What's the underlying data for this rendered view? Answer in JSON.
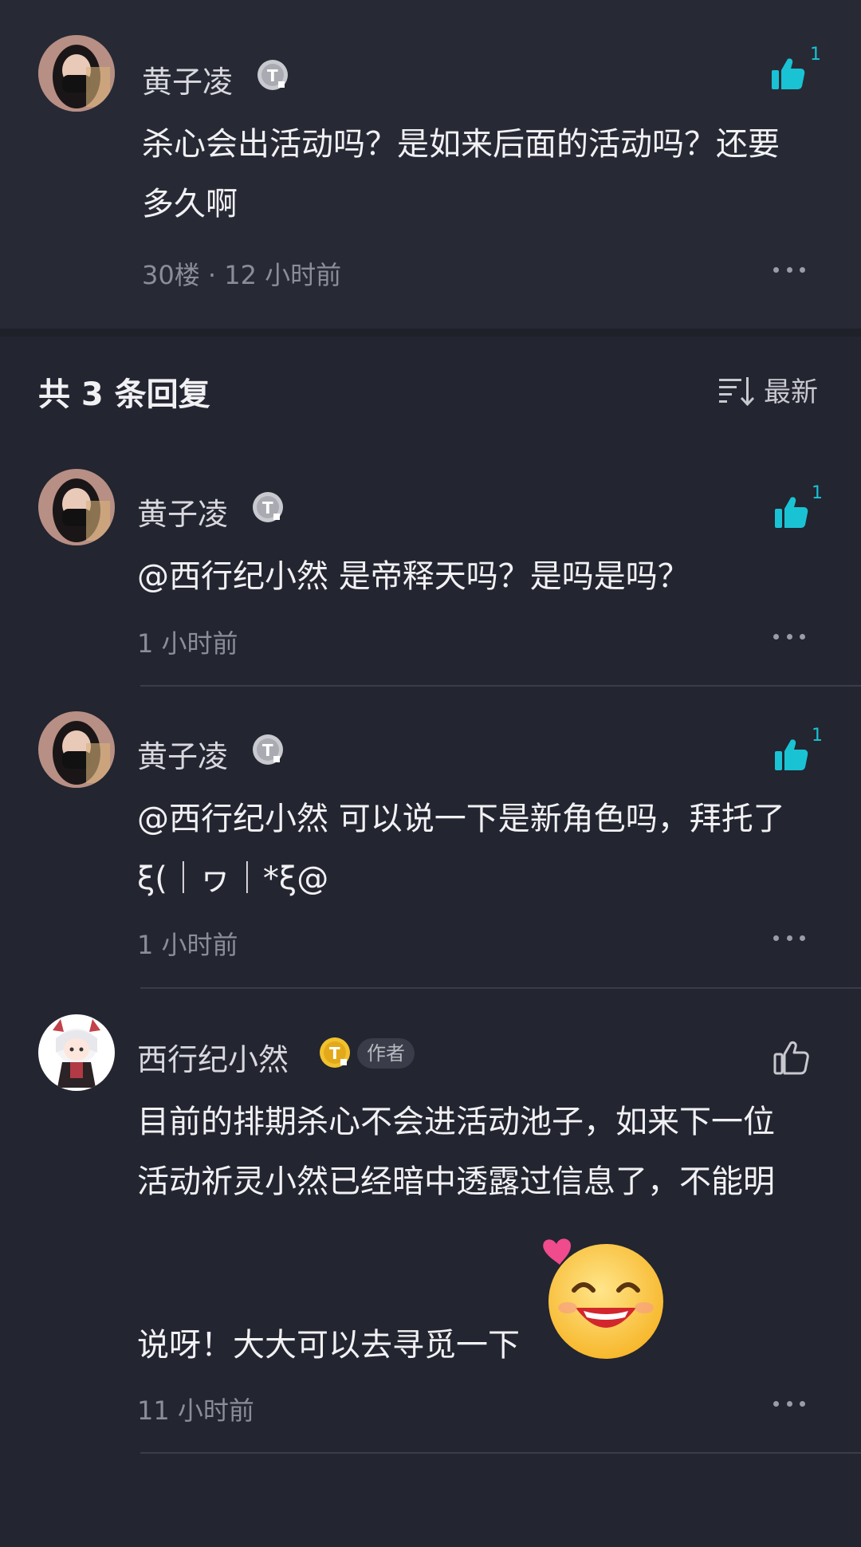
{
  "main_comment": {
    "username": "黄子凌",
    "like_count": "1",
    "text_lines": [
      "杀心会出活动吗？是如来后面的活动吗？还要",
      "多久啊"
    ],
    "meta": "30楼 · 12 小时前"
  },
  "replies_header": {
    "title": "共 3 条回复",
    "sort_label": "最新"
  },
  "replies": [
    {
      "username": "黄子凌",
      "like_count": "1",
      "text_lines": [
        "@西行纪小然  是帝释天吗？是吗是吗？"
      ],
      "time": "1 小时前"
    },
    {
      "username": "黄子凌",
      "like_count": "1",
      "text_lines": [
        "@西行纪小然  可以说一下是新角色吗，拜托了",
        "ξ(｜ヮ｜*ξ@"
      ],
      "time": "1 小时前"
    },
    {
      "username": "西行纪小然",
      "author_tag": "作者",
      "text_lines": [
        "目前的排期杀心不会进活动池子，如来下一位",
        "活动祈灵小然已经暗中透露过信息了，不能明",
        "说呀！大大可以去寻觅一下"
      ],
      "time": "11 小时前"
    }
  ],
  "colors": {
    "background": "#232530",
    "accent_like": "#19c3d4",
    "meta_text": "#8b8d98"
  },
  "icons": [
    "thumbs-up-filled-icon",
    "thumbs-up-outline-icon",
    "more-dots-icon",
    "sort-icon",
    "level-badge-icon",
    "laughing-emoji-icon"
  ]
}
